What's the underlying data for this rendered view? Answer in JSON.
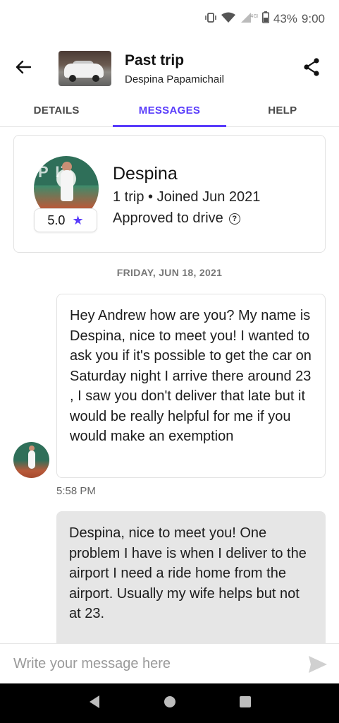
{
  "status_bar": {
    "battery_text": "43%",
    "time": "9:00",
    "network_label": "4GE",
    "icons": [
      "vibrate-icon",
      "wifi-icon",
      "signal-icon",
      "battery-icon"
    ]
  },
  "header": {
    "title": "Past trip",
    "subtitle": "Despina Papamichail",
    "icons": [
      "back-arrow-icon",
      "car-thumbnail",
      "share-icon"
    ]
  },
  "tabs": [
    {
      "label": "DETAILS",
      "active": false
    },
    {
      "label": "MESSAGES",
      "active": true
    },
    {
      "label": "HELP",
      "active": false
    }
  ],
  "profile": {
    "name": "Despina",
    "meta": "1 trip • Joined Jun 2021",
    "approved": "Approved to drive",
    "rating": "5.0",
    "help_symbol": "?"
  },
  "conversation": {
    "date_label": "FRIDAY, JUN 18, 2021",
    "messages": [
      {
        "from": "Despina",
        "text": "Hey Andrew how are you? My name is Despina, nice to meet you! I wanted to ask you if it's possible to get the car on Saturday night I arrive there around 23 , I saw you don't deliver that late but it would be really helpful for me if you would make an exemption",
        "time": "5:58 PM"
      },
      {
        "from": "me",
        "text": "Despina, nice to meet you!  One problem I have is  when I deliver to the airport I need a ride home from the airport. Usually my wife helps but not at 23."
      }
    ]
  },
  "composer": {
    "placeholder": "Write your message here"
  },
  "colors": {
    "accent": "#593cfb",
    "outgoing_bubble": "#e6e6e6",
    "navbar": "#000000"
  }
}
